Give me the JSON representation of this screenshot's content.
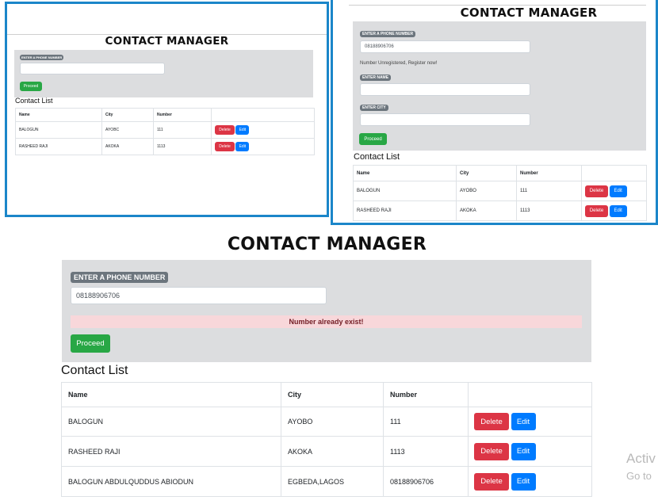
{
  "app_title": "CONTACT MANAGER",
  "phone_label": "ENTER A PHONE NUMBER",
  "name_label": "ENTER NAME",
  "city_label": "ENTER CITY",
  "proceed_label": "Proceed",
  "contact_list_title": "Contact List",
  "columns": [
    "Name",
    "City",
    "Number",
    ""
  ],
  "delete_label": "Delete",
  "edit_label": "Edit",
  "panel_tl": {
    "phone_value": "",
    "rows": [
      {
        "name": "BALOGUN",
        "city": "AYOBC",
        "number": "111"
      },
      {
        "name": "RASHEED RAJI",
        "city": "AKOKA",
        "number": "1113"
      }
    ]
  },
  "panel_tr": {
    "phone_value": "08188906706",
    "message": "Number Unregistered, Register now!",
    "name_value": "",
    "city_value": "",
    "rows": [
      {
        "name": "BALOGUN",
        "city": "AYOBO",
        "number": "111"
      },
      {
        "name": "RASHEED RAJI",
        "city": "AKOKA",
        "number": "1113"
      }
    ]
  },
  "panel_main": {
    "phone_value": "08188906706",
    "alert": "Number already exist!",
    "rows": [
      {
        "name": "BALOGUN",
        "city": "AYOBO",
        "number": "111"
      },
      {
        "name": "RASHEED RAJI",
        "city": "AKOKA",
        "number": "1113"
      },
      {
        "name": "BALOGUN ABDULQUDDUS ABIODUN",
        "city": "EGBEDA,LAGOS",
        "number": "08188906706"
      }
    ]
  },
  "watermark": {
    "line1": "Activ",
    "line2": "Go to"
  },
  "colors": {
    "frame": "#1b86c9",
    "form_bg": "#dcdddf",
    "success": "#28a745",
    "danger": "#dc3545",
    "primary": "#007bff",
    "alert_bg": "#f8d7da"
  }
}
